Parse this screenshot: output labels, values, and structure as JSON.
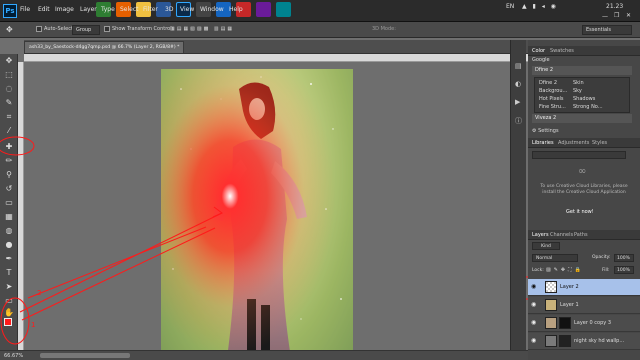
{
  "app": {
    "ps_logo": "Ps",
    "menu": [
      "File",
      "Edit",
      "Image",
      "Layer",
      "Type",
      "Select",
      "Filter",
      "3D",
      "View",
      "Window",
      "Help"
    ],
    "tray": {
      "lang": "EN",
      "time": "21.23"
    }
  },
  "options_bar": {
    "auto_select_label": "Auto-Select:",
    "auto_select_value": "Group",
    "transform_label": "Show Transform Controls",
    "mode_label": "3D Mode:",
    "workspace": "Essentials"
  },
  "document": {
    "tab_title": "ash33_by_Saestock-d4gg7qmp.psd @ 66.7% (Layer 2, RGB/8#) *",
    "zoom": "66.67%"
  },
  "annotations": {
    "num_1": "1",
    "num_2": "2"
  },
  "right_panel": {
    "color_tabs": [
      "Color",
      "Swatches"
    ],
    "google_label": "Google",
    "properties_group1": "Dfine 2",
    "properties_rows": [
      [
        "Dfine 2",
        "Skin"
      ],
      [
        "Backgrou...",
        "Sky"
      ],
      [
        "Hot Pixels",
        "Shadows"
      ],
      [
        "Fine Stru...",
        "Strong No..."
      ]
    ],
    "properties_group2": "Viveza 2",
    "settings_label": "Settings",
    "lib_tabs": [
      "Libraries",
      "Adjustments",
      "Styles"
    ],
    "cc_message": "To use Creative Cloud Libraries, please install the Creative Cloud Application",
    "cc_link": "Get it now!",
    "layers_tabs": [
      "Layers",
      "Channels",
      "Paths"
    ],
    "kind_label": "Kind",
    "blend_mode": "Normal",
    "opacity_label": "Opacity:",
    "opacity_value": "100%",
    "lock_label": "Lock:",
    "fill_label": "Fill:",
    "fill_value": "100%",
    "layers": [
      {
        "name": "Layer 2",
        "selected": true
      },
      {
        "name": "Layer 1",
        "selected": false
      },
      {
        "name": "Layer 0 copy 3",
        "selected": false
      },
      {
        "name": "night sky hd wallp...",
        "selected": false
      }
    ]
  },
  "colors": {
    "accent_red": "#ff1a1a",
    "selected_layer": "#a7c1ea"
  }
}
